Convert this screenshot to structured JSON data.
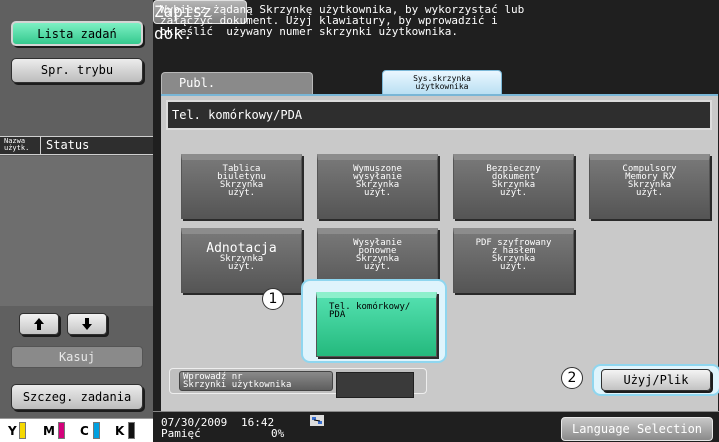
{
  "left_panel": {
    "job_list_button": "Lista zadań",
    "mode_check_button": "Spr. trybu",
    "status_header": {
      "name_label": "Nazwa\nużytk.",
      "status_label": "Status"
    },
    "delete_button": "Kasuj",
    "job_details_button": "Szczeg. zadania",
    "toner": [
      {
        "letter": "Y",
        "color": "#f5d800"
      },
      {
        "letter": "M",
        "color": "#d4007a"
      },
      {
        "letter": "C",
        "color": "#00a0e0"
      },
      {
        "letter": "K",
        "color": "#111111"
      }
    ]
  },
  "message": "Wybierz żądaną Skrzynkę użytkownika, by wykorzystać lub\nzałączyć dokument. Użyj klawiatury, by wprowadzić i\nokreślić  używany numer skrzynki użytkownika.",
  "tabs": {
    "public": "Publ.",
    "system_box": "Sys.skrzynka\nużytkownika",
    "save_document": "Zapisz dok."
  },
  "category": "Tel. komórkowy/PDA",
  "boxes": [
    {
      "label": "Tablica\nbiuletynu\nSkrzynka\nużyt."
    },
    {
      "label": "Wymuszone\nwysyłanie\nSkrzynka\nużyt."
    },
    {
      "label": "Bezpieczny\ndokument\nSkrzynka\nużyt."
    },
    {
      "label": "Compulsory\nMemory RX\nSkrzynka\nużyt."
    },
    {
      "label": "Adnotacja",
      "sub": "Skrzynka\nużyt."
    },
    {
      "label": "Wysyłanie\nponowne\nSkrzynka\nużyt."
    },
    {
      "label": "PDF szyfrowany\nz hasłem\nSkrzynka\nużyt."
    }
  ],
  "selected_box": "Tel. komórkowy/\nPDA",
  "callouts": {
    "one": "1",
    "two": "2"
  },
  "enter_number_button": "Wprowadź nr\nSkrzynki użytkownika",
  "use_file_button": "Użyj/Plik",
  "footer": {
    "date": "07/30/2009",
    "time": "16:42",
    "memory_label": "Pamięć",
    "memory_value": "0%",
    "language_button": "Language Selection"
  }
}
